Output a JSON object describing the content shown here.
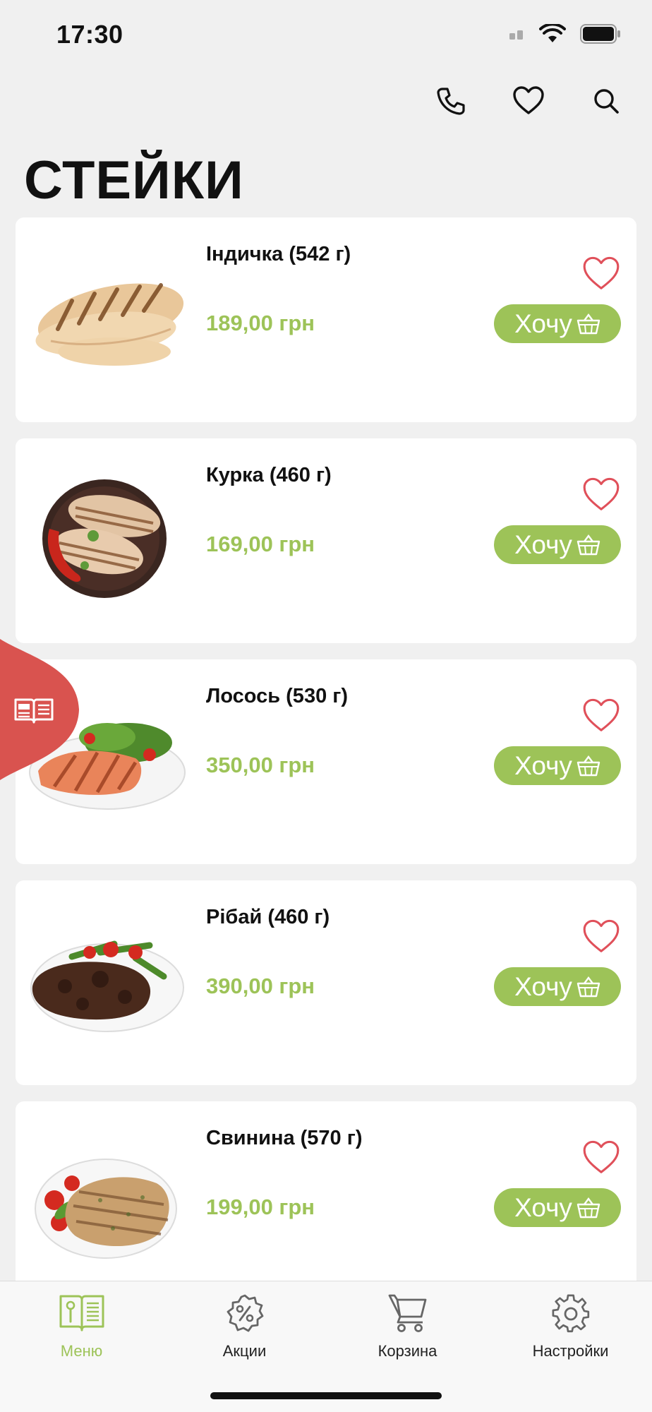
{
  "status_bar": {
    "time": "17:30"
  },
  "header": {
    "title": "СТЕЙКИ"
  },
  "products": [
    {
      "name": "Індичка (542 г)",
      "price": "189,00 грн",
      "button": "Хочу",
      "image": "turkey-steak"
    },
    {
      "name": "Курка (460 г)",
      "price": "169,00 грн",
      "button": "Хочу",
      "image": "chicken-steak"
    },
    {
      "name": "Лосось (530 г)",
      "price": "350,00 грн",
      "button": "Хочу",
      "image": "salmon-steak"
    },
    {
      "name": "Рібай (460 г)",
      "price": "390,00 грн",
      "button": "Хочу",
      "image": "ribeye-steak"
    },
    {
      "name": "Свинина (570 г)",
      "price": "199,00 грн",
      "button": "Хочу",
      "image": "pork-steak"
    }
  ],
  "nav": {
    "items": [
      {
        "label": "Меню",
        "icon": "menu-book-icon",
        "active": true
      },
      {
        "label": "Акции",
        "icon": "discount-icon",
        "active": false
      },
      {
        "label": "Корзина",
        "icon": "cart-icon",
        "active": false
      },
      {
        "label": "Настройки",
        "icon": "settings-icon",
        "active": false
      }
    ]
  },
  "colors": {
    "accent": "#9dc358",
    "heart": "#e0505a",
    "tab": "#d9534f"
  }
}
